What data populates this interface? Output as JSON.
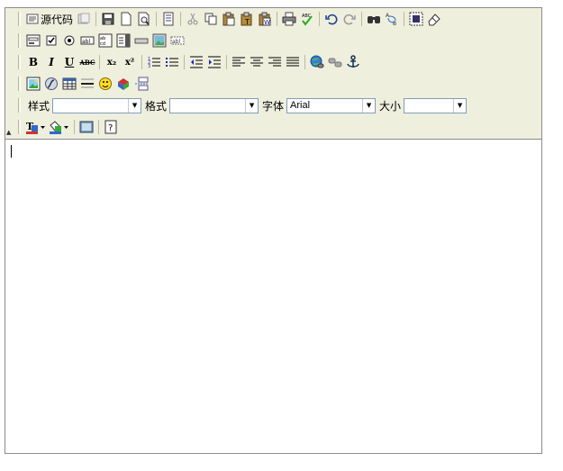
{
  "toolbar": {
    "source_label": "源代码",
    "style_label": "样式",
    "format_label": "格式",
    "font_label": "字体",
    "size_label": "大小",
    "style_value": "",
    "format_value": "",
    "font_value": "Arial",
    "size_value": ""
  },
  "icons": {
    "row1": [
      "source-icon",
      "templates-icon",
      "save-icon",
      "new-page-icon",
      "preview-icon",
      "templates-icon",
      "cut-icon",
      "copy-icon",
      "paste-icon",
      "paste-text-icon",
      "paste-word-icon",
      "print-icon",
      "spellcheck-icon",
      "undo-icon",
      "redo-icon",
      "find-icon",
      "replace-icon",
      "select-all-icon",
      "remove-format-icon"
    ],
    "row2": [
      "form-icon",
      "checkbox-icon",
      "radio-icon",
      "textfield-icon",
      "textarea-icon",
      "select-icon",
      "button-icon",
      "image-button-icon",
      "hidden-field-icon"
    ],
    "row3": [
      "bold-icon",
      "italic-icon",
      "underline-icon",
      "strike-icon",
      "subscript-icon",
      "superscript-icon",
      "ordered-list-icon",
      "unordered-list-icon",
      "outdent-icon",
      "indent-icon",
      "align-left-icon",
      "align-center-icon",
      "align-right-icon",
      "justify-icon",
      "link-icon",
      "unlink-icon",
      "anchor-icon"
    ],
    "row4": [
      "image-icon",
      "flash-icon",
      "table-icon",
      "horizontal-rule-icon",
      "smiley-icon",
      "special-char-icon",
      "page-break-icon"
    ],
    "row6": [
      "text-color-icon",
      "bg-color-icon",
      "maximize-icon",
      "about-icon"
    ]
  },
  "text_buttons": {
    "bold": "B",
    "italic": "I",
    "underline": "U",
    "strike": "ABC",
    "subscript": "x₂",
    "superscript": "x²"
  },
  "colors": {
    "toolbar_bg": "#efefde",
    "border": "#8c8c8c"
  }
}
